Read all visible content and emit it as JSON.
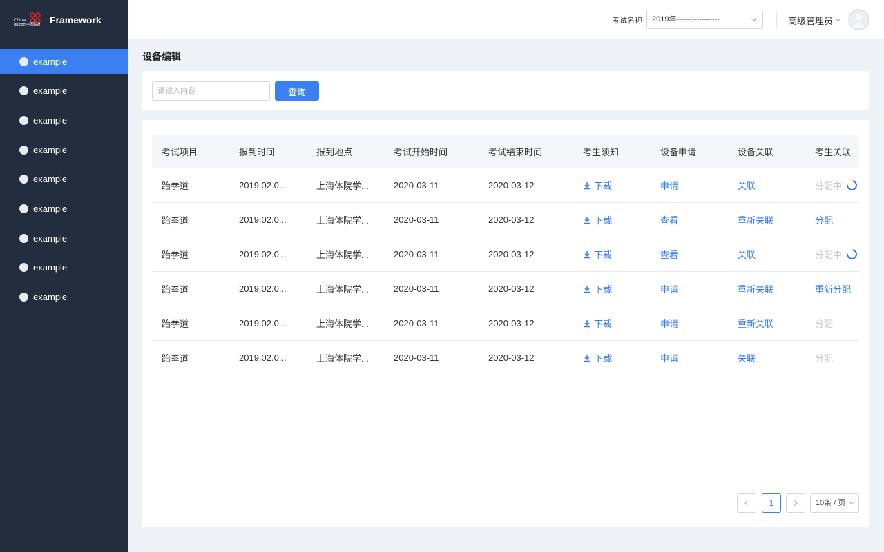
{
  "sidebar": {
    "logo_line1": "China",
    "logo_line2": "unicom中国联通",
    "logo_text": "Framework",
    "items": [
      {
        "label": "example",
        "active": true
      },
      {
        "label": "example",
        "active": false
      },
      {
        "label": "example",
        "active": false
      },
      {
        "label": "example",
        "active": false
      },
      {
        "label": "example",
        "active": false
      },
      {
        "label": "example",
        "active": false
      },
      {
        "label": "example",
        "active": false
      },
      {
        "label": "example",
        "active": false
      },
      {
        "label": "example",
        "active": false
      }
    ]
  },
  "header": {
    "exam_label": "考试名称",
    "exam_value": "2019年-----------------",
    "user_name": "高级管理员"
  },
  "page": {
    "title": "设备编辑",
    "search_placeholder": "请输入内容",
    "search_button": "查询"
  },
  "table": {
    "columns": [
      "考试项目",
      "报到时间",
      "报到地点",
      "考试开始时间",
      "考试结束时间",
      "考生须知",
      "设备申请",
      "设备关联",
      "考生关联"
    ],
    "rows": [
      {
        "project": "跆拳道",
        "checkin_time": "2019.02.0...",
        "location": "上海体院学...",
        "start": "2020-03-11",
        "end": "2020-03-12",
        "notice": "下载",
        "apply": "申请",
        "device_link": "关联",
        "student_link": "分配中",
        "student_state": "loading"
      },
      {
        "project": "跆拳道",
        "checkin_time": "2019.02.0...",
        "location": "上海体院学...",
        "start": "2020-03-11",
        "end": "2020-03-12",
        "notice": "下载",
        "apply": "查看",
        "device_link": "重新关联",
        "student_link": "分配",
        "student_state": "link"
      },
      {
        "project": "跆拳道",
        "checkin_time": "2019.02.0...",
        "location": "上海体院学...",
        "start": "2020-03-11",
        "end": "2020-03-12",
        "notice": "下载",
        "apply": "查看",
        "device_link": "关联",
        "student_link": "分配中",
        "student_state": "loading"
      },
      {
        "project": "跆拳道",
        "checkin_time": "2019.02.0...",
        "location": "上海体院学...",
        "start": "2020-03-11",
        "end": "2020-03-12",
        "notice": "下载",
        "apply": "申请",
        "device_link": "重新关联",
        "student_link": "重新分配",
        "student_state": "link"
      },
      {
        "project": "跆拳道",
        "checkin_time": "2019.02.0...",
        "location": "上海体院学...",
        "start": "2020-03-11",
        "end": "2020-03-12",
        "notice": "下载",
        "apply": "申请",
        "device_link": "重新关联",
        "student_link": "分配",
        "student_state": "disabled"
      },
      {
        "project": "跆拳道",
        "checkin_time": "2019.02.0...",
        "location": "上海体院学...",
        "start": "2020-03-11",
        "end": "2020-03-12",
        "notice": "下载",
        "apply": "申请",
        "device_link": "关联",
        "student_link": "分配",
        "student_state": "disabled"
      }
    ]
  },
  "pagination": {
    "prev": "<",
    "current": "1",
    "next": ">",
    "page_size": "10条 / 页"
  },
  "colors": {
    "accent": "#3a80f0",
    "sidebar_bg": "#232d3e",
    "link": "#2f7bf0",
    "disabled": "#c2c6cd",
    "logo_red": "#e1251b"
  },
  "icons": [
    "unicom-logo-icon",
    "chevron-down-icon",
    "avatar-icon",
    "download-icon",
    "loading-spinner-icon",
    "chevron-left-icon",
    "chevron-right-icon"
  ]
}
